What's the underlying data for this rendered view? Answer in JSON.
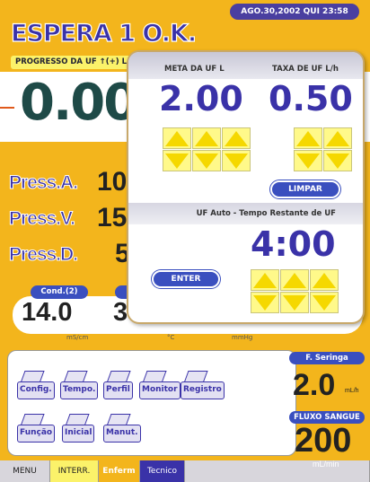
{
  "header": {
    "datetime": "AGO.30,2002 QUI 23:58",
    "title": "ESPERA 1 O.K.",
    "progress_label": "PROGRESSO DA UF ↑(+) L",
    "uf_value": "0.00"
  },
  "pressures": [
    {
      "label": "Press.A.",
      "value": "10"
    },
    {
      "label": "Press.V.",
      "value": "15"
    },
    {
      "label": "Press.D.",
      "value": "5"
    }
  ],
  "cond": {
    "label": "Cond.(2)",
    "value": "14.0",
    "value2": "3",
    "units": [
      "mS/cm",
      "°C",
      "mmHg"
    ]
  },
  "dialog": {
    "meta_label": "META DA UF L",
    "meta_value": "2.00",
    "taxa_label": "TAXA DE UF L/h",
    "taxa_value": "0.50",
    "limpar_label": "LIMPAR",
    "auto_label": "UF Auto - Tempo Restante de UF",
    "tempo_value": "4:00",
    "enter_label": "ENTER"
  },
  "folders": [
    {
      "label": "Config."
    },
    {
      "label": "Tempo."
    },
    {
      "label": "Perfil"
    },
    {
      "label": "Monitor"
    },
    {
      "label": "Registro"
    },
    {
      "label": "Função"
    },
    {
      "label": "Inicial"
    },
    {
      "label": "Manut."
    }
  ],
  "right_panel": {
    "seringa_label": "F. Seringa",
    "seringa_value": "2.0",
    "seringa_unit": "mL/h",
    "fluxo_label": "FLUXO SANGUE",
    "fluxo_value": "200",
    "fluxo_unit": "mL/min"
  },
  "tabs": {
    "menu": "MENU",
    "interr": "INTERR.",
    "enferm": "Enferm",
    "tecnico": "Tecnico"
  },
  "colors": {
    "background": "#f3b51c",
    "accent_blue": "#3a32a8",
    "button_yellow": "#fff98a"
  }
}
